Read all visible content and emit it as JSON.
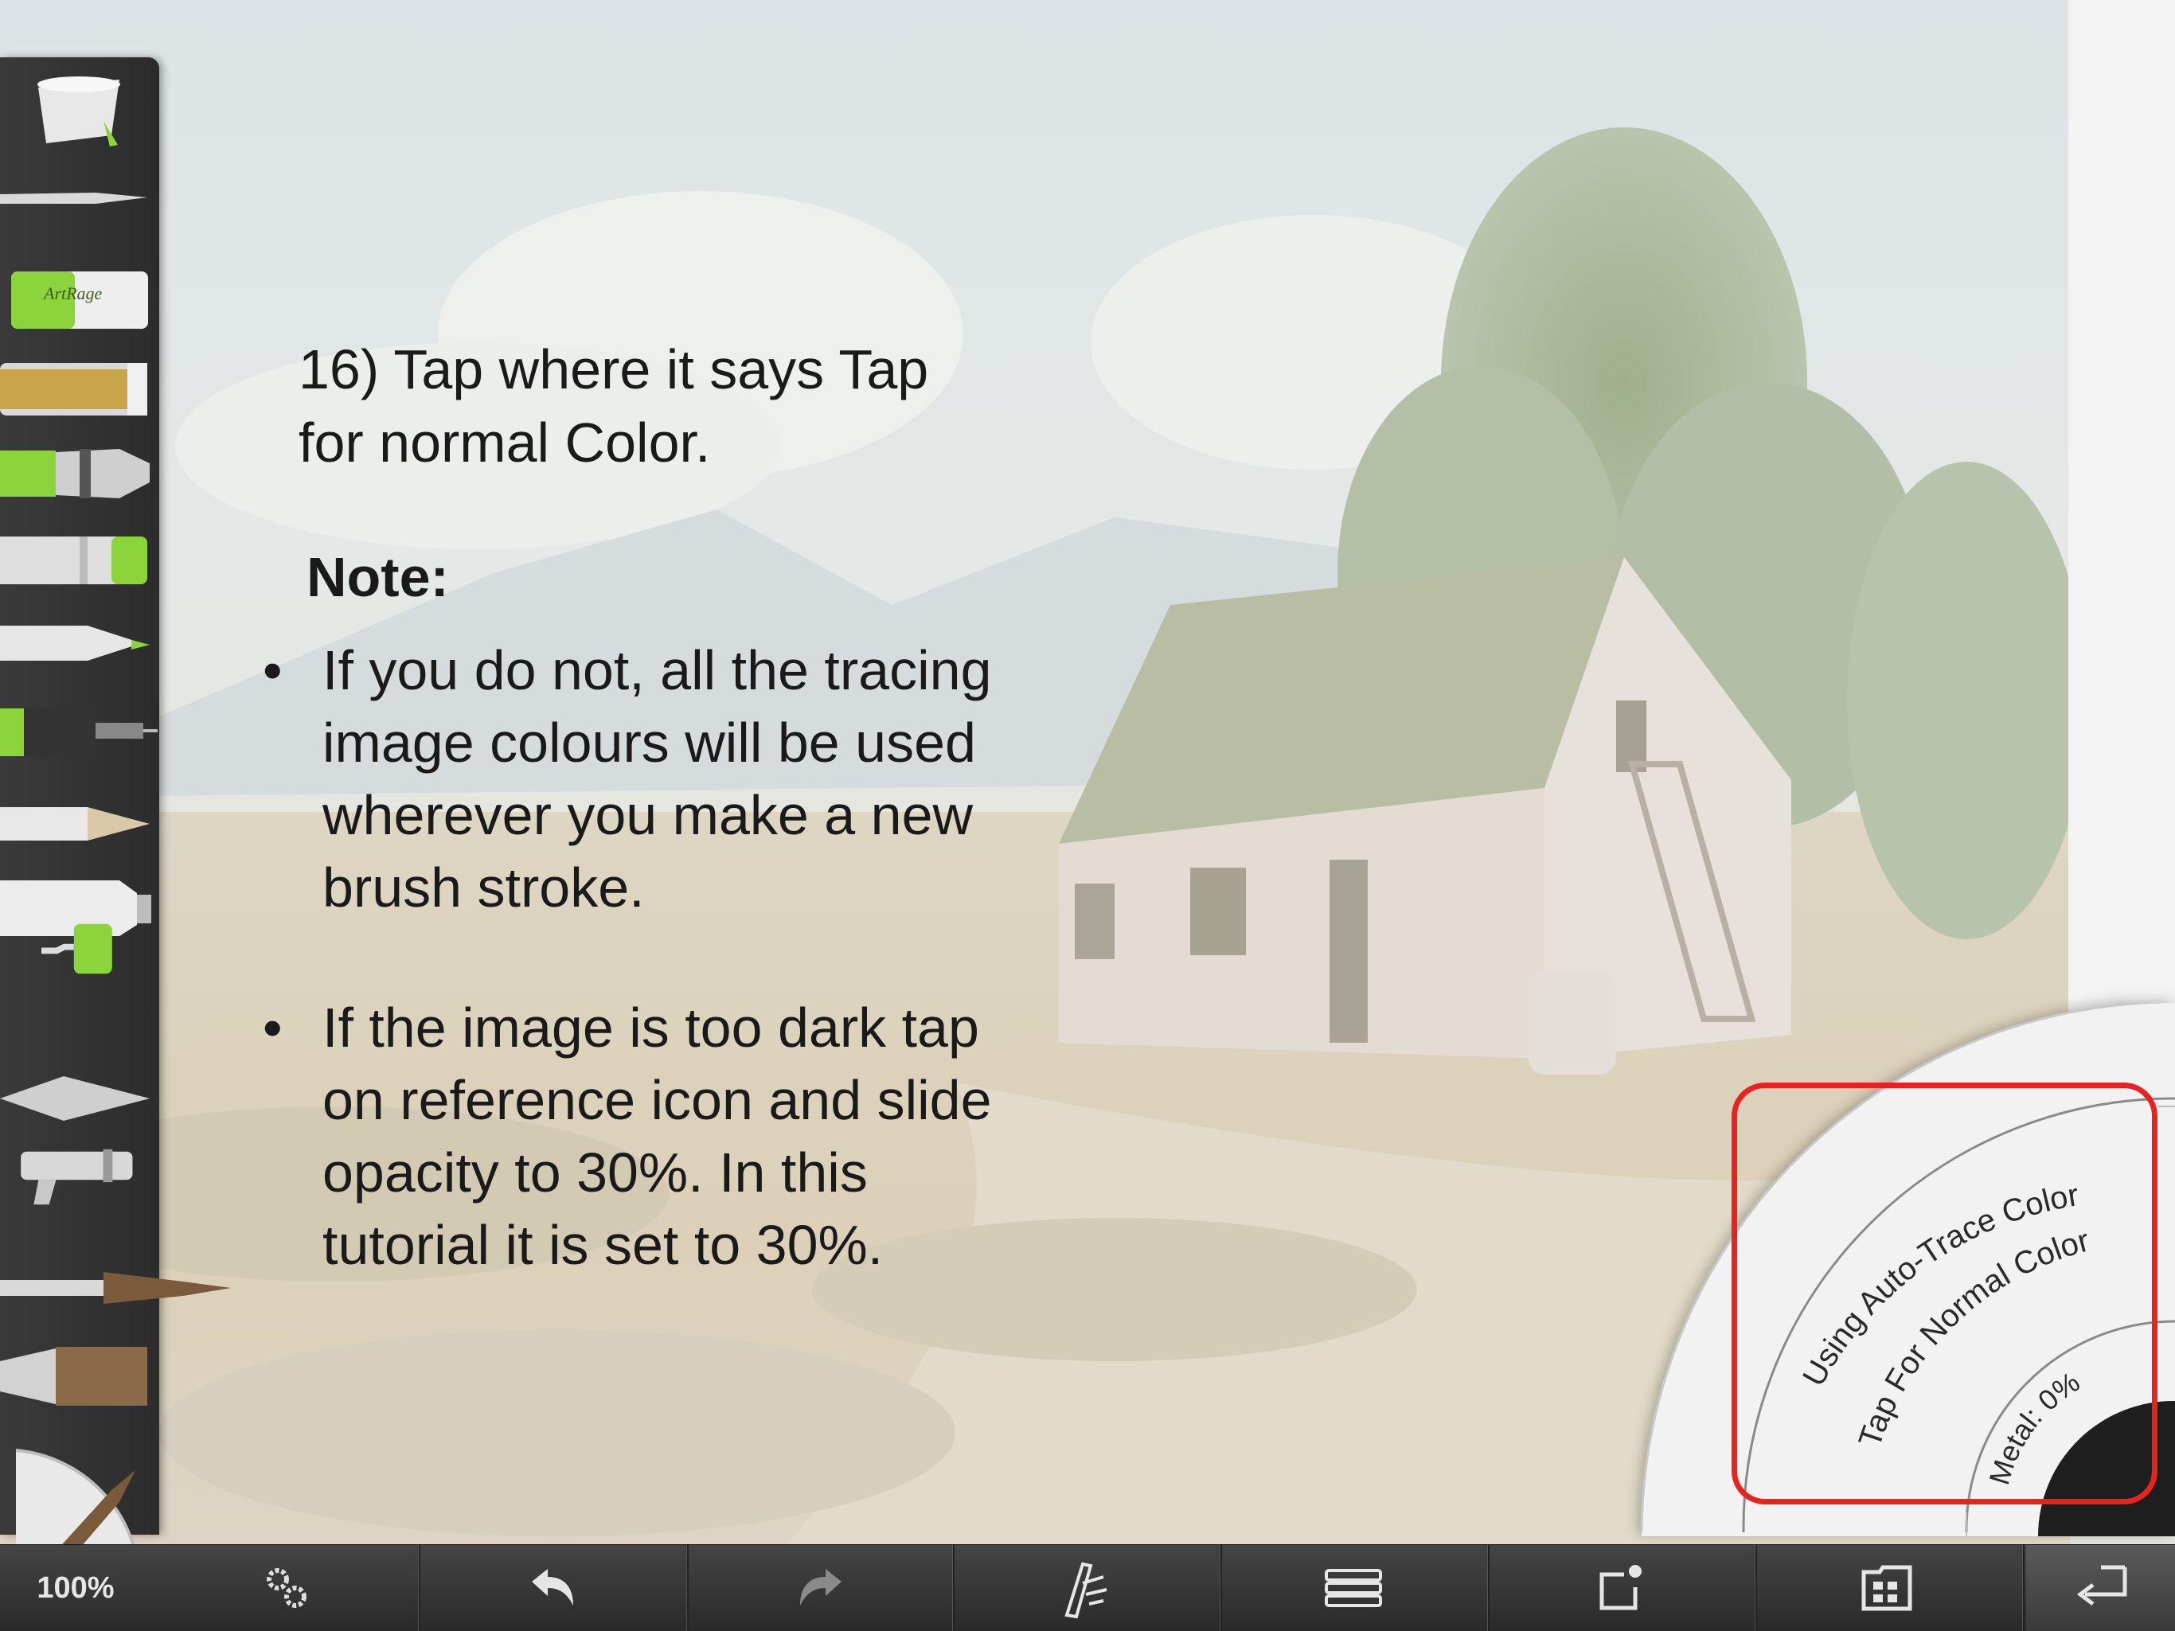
{
  "instructions": {
    "step_line1": "16) Tap where it says Tap",
    "step_line2": "for normal Color.",
    "note_heading": "Note:",
    "bullet_symbol": "•",
    "bullets": [
      {
        "lines": [
          "If you do not, all the tracing",
          "image colours will be used",
          "wherever you make a new",
          "brush stroke."
        ]
      },
      {
        "lines": [
          "If the image is too dark tap",
          "on reference icon and slide",
          "opacity to 30%. In this",
          "tutorial it is set to 30%."
        ]
      }
    ]
  },
  "tools": [
    {
      "name": "paint-bucket"
    },
    {
      "name": "palette-knife"
    },
    {
      "name": "eraser"
    },
    {
      "name": "glitter-tube"
    },
    {
      "name": "marker"
    },
    {
      "name": "chalk"
    },
    {
      "name": "felt-pen"
    },
    {
      "name": "ink-pen"
    },
    {
      "name": "pencil"
    },
    {
      "name": "paint-tube"
    },
    {
      "name": "roller"
    },
    {
      "name": "palette-knife-flat"
    },
    {
      "name": "airbrush"
    },
    {
      "name": "oil-brush"
    },
    {
      "name": "flat-brush"
    }
  ],
  "eraser_brand": "ArtRage",
  "color_picker": {
    "status_text": "Using Auto-Trace Color",
    "action_text": "Tap For Normal Color",
    "metal_text": "Metal: 0%"
  },
  "toolbar": {
    "zoom": "100%",
    "buttons": [
      "settings",
      "undo",
      "redo",
      "tracing",
      "layers",
      "share",
      "gallery",
      "collapse"
    ]
  },
  "colors": {
    "highlight": "#e8231f",
    "tool_accent": "#8cd43c",
    "toolbar_bg": "#333333"
  }
}
